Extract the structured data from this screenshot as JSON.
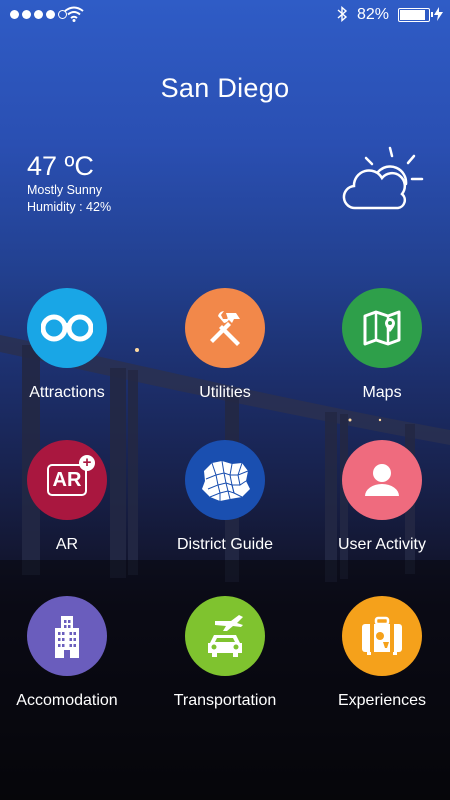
{
  "status_bar": {
    "battery_percent": "82%",
    "signal_bars_filled": 4,
    "signal_bars_total": 5,
    "icons": [
      "signal-icon",
      "wifi-icon",
      "bluetooth-icon",
      "battery-icon",
      "charging-icon"
    ]
  },
  "city": "San Diego",
  "weather": {
    "temperature": "47 ºC",
    "condition": "Mostly Sunny",
    "humidity": "Humidity : 42%",
    "icon": "partly-sunny-icon"
  },
  "tiles": [
    {
      "label": "Attractions",
      "icon": "binoculars-icon",
      "color": "#19a6e6"
    },
    {
      "label": "Utilities",
      "icon": "tools-icon",
      "color": "#f2884a"
    },
    {
      "label": "Maps",
      "icon": "map-icon",
      "color": "#2e9f4a"
    },
    {
      "label": "AR",
      "icon": "ar-icon",
      "icon_text": "AR",
      "color": "#a9173f"
    },
    {
      "label": "District Guide",
      "icon": "district-map-icon",
      "color": "#1a4fb0"
    },
    {
      "label": "User Activity",
      "icon": "user-icon",
      "color": "#ef6b7e"
    },
    {
      "label": "Accomodation",
      "icon": "building-icon",
      "color": "#6a5dbd"
    },
    {
      "label": "Transportation",
      "icon": "transport-icon",
      "color": "#7fc32f"
    },
    {
      "label": "Experiences",
      "icon": "luggage-icon",
      "color": "#f5a11b"
    }
  ]
}
